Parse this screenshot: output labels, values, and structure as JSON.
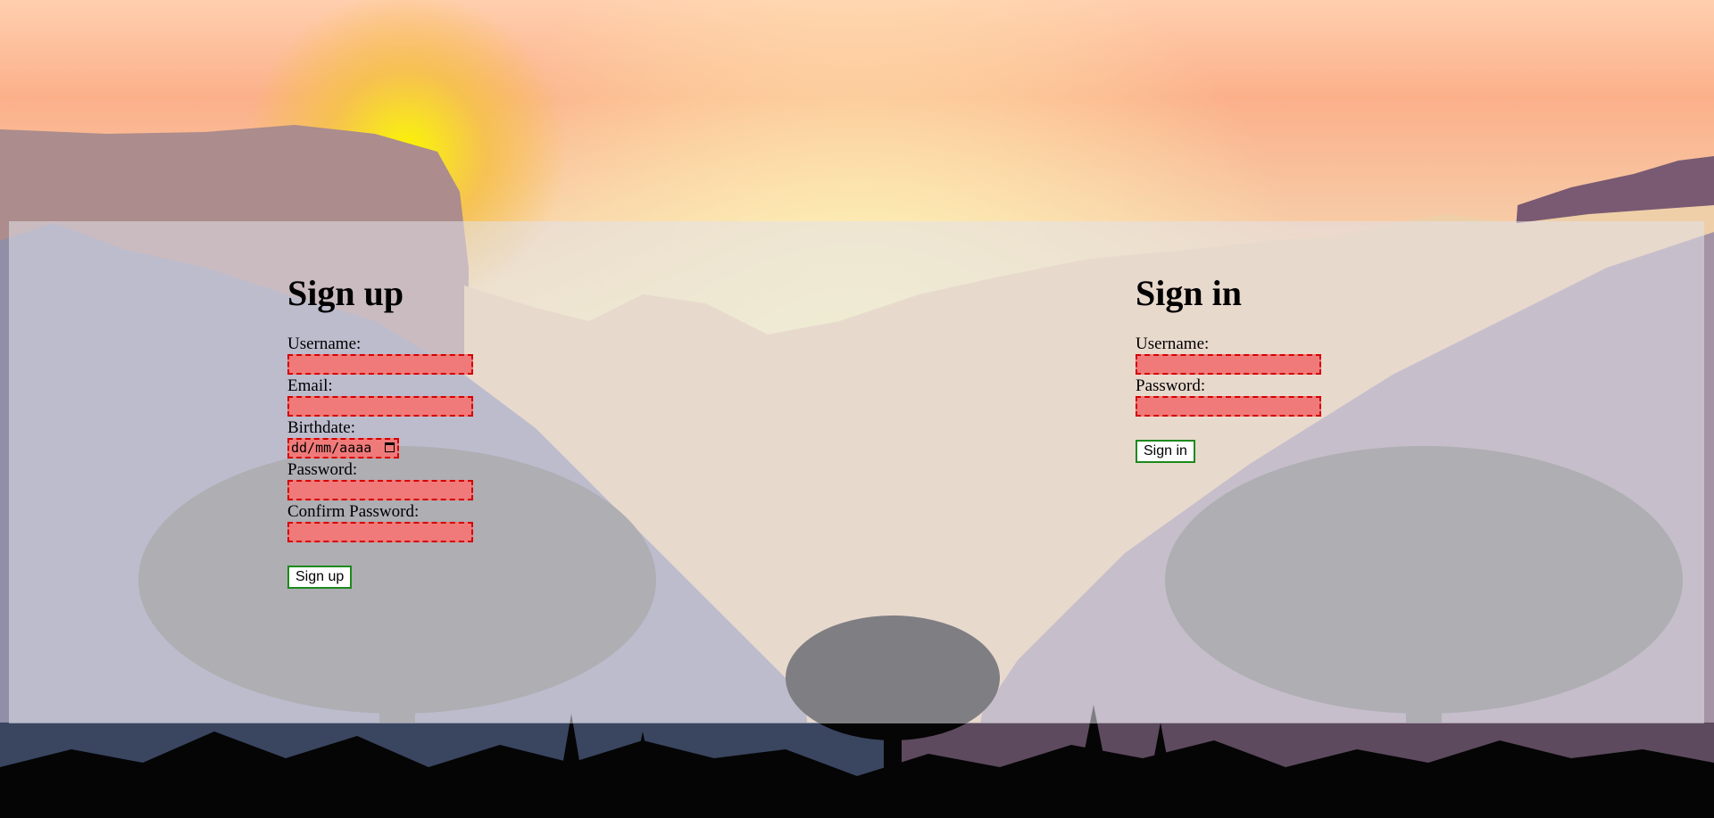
{
  "signup": {
    "title": "Sign up",
    "fields": {
      "username_label": "Username:",
      "email_label": "Email:",
      "birthdate_label": "Birthdate:",
      "birthdate_placeholder": "dd/mm/aaaa",
      "password_label": "Password:",
      "confirm_label": "Confirm Password:"
    },
    "button_label": "Sign up"
  },
  "signin": {
    "title": "Sign in",
    "fields": {
      "username_label": "Username:",
      "password_label": "Password:"
    },
    "button_label": "Sign in"
  },
  "icons": {
    "calendar": "calendar-icon"
  },
  "colors": {
    "invalid_fill": "#f07a7a",
    "invalid_border": "#d40000",
    "button_border": "#1c8a1c"
  }
}
